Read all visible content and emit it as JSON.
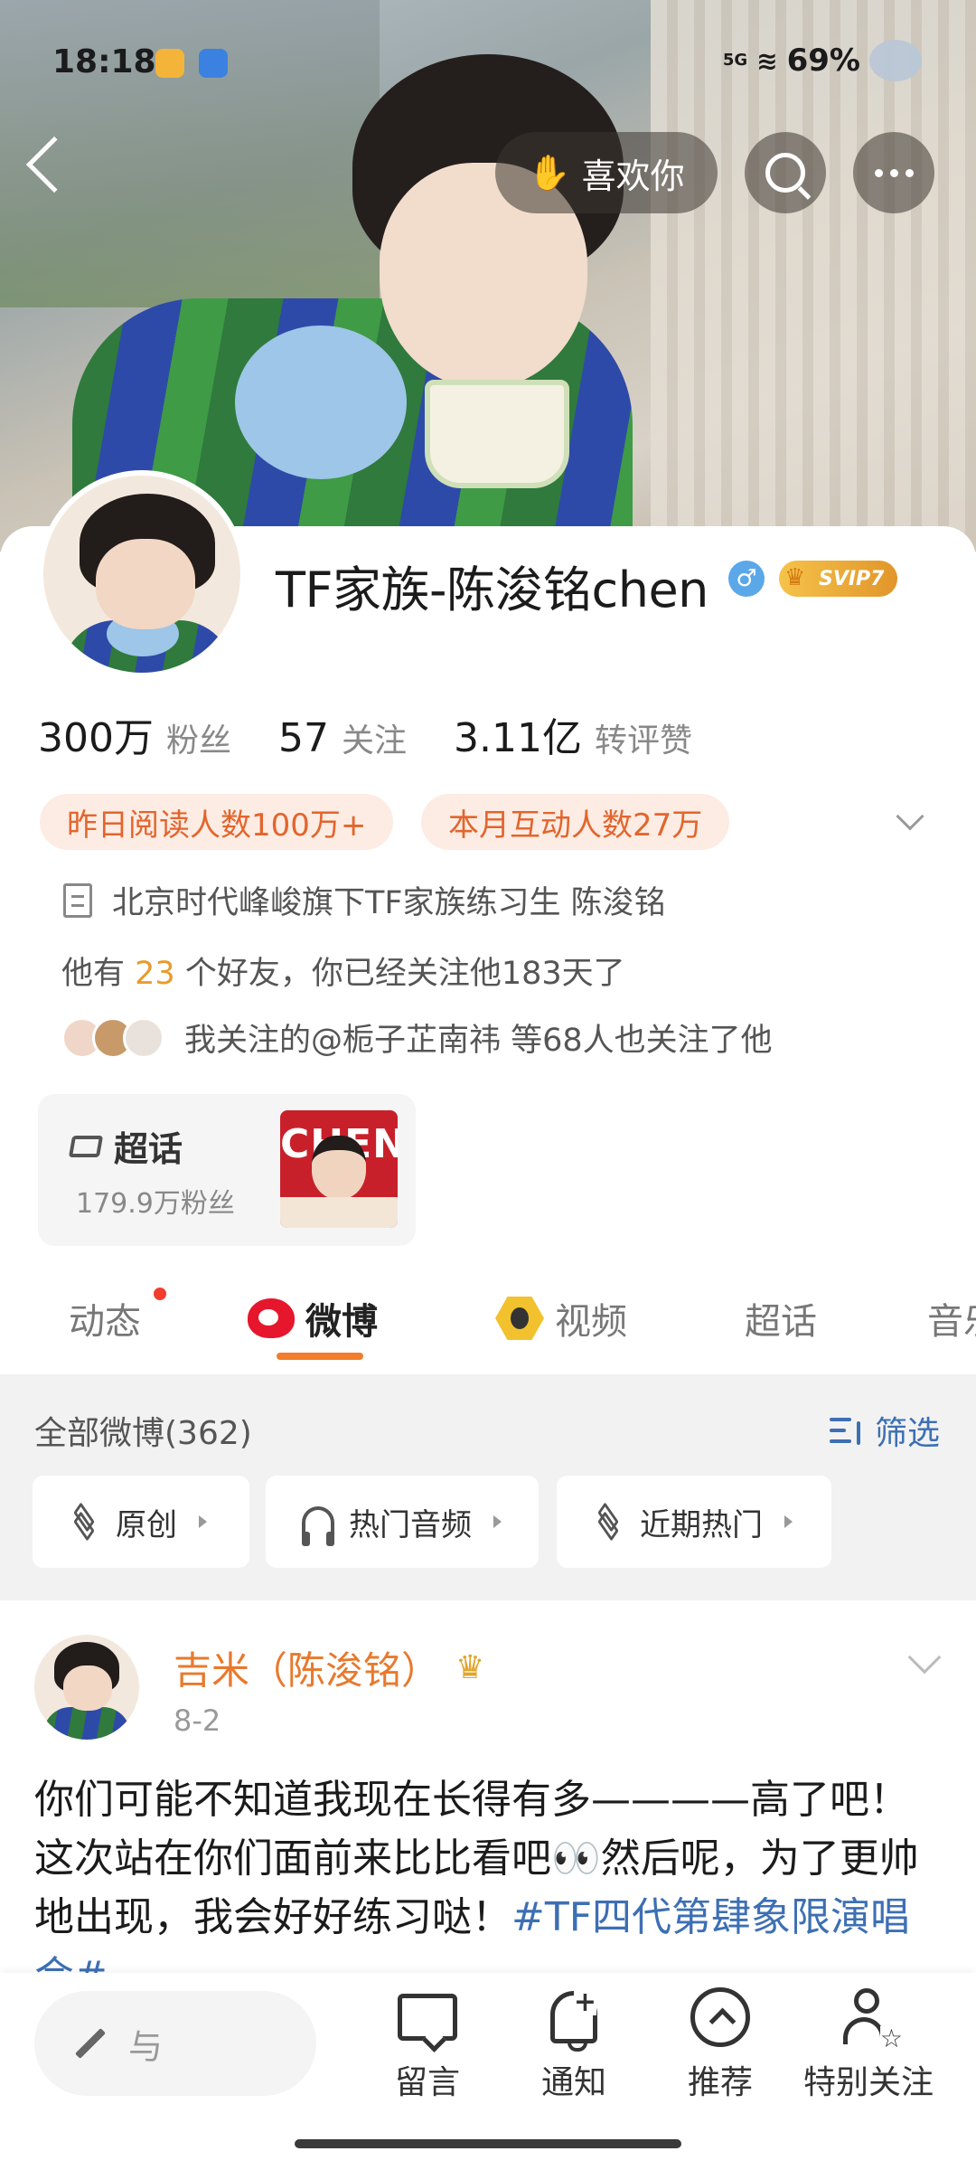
{
  "status_bar": {
    "time": "18:18",
    "network": "5G",
    "battery": "69%"
  },
  "top_bar": {
    "like_label": "喜欢你"
  },
  "profile": {
    "name": "TF家族-陈浚铭chen",
    "gender_symbol": "♂",
    "vip_badge": "SVIP7",
    "stats": [
      {
        "value": "300万",
        "label": "粉丝"
      },
      {
        "value": "57",
        "label": "关注"
      },
      {
        "value": "3.11亿",
        "label": "转评赞"
      }
    ],
    "pills": [
      "昨日阅读人数100万+",
      "本月互动人数27万"
    ],
    "intro": "北京时代峰峻旗下TF家族练习生  陈浚铭",
    "friends_prefix": "他有 ",
    "friends_count": "23",
    "friends_suffix": " 个好友，你已经关注他183天了",
    "mutual_text": "我关注的@栀子芷南祎 等68人也关注了他",
    "super_topic": {
      "title": "超话",
      "fans": "179.9万粉丝",
      "thumb_text": "CHEN"
    }
  },
  "tabs": [
    {
      "label": "动态",
      "active": false
    },
    {
      "label": "微博",
      "active": true
    },
    {
      "label": "视频",
      "active": false
    },
    {
      "label": "超话",
      "active": false
    },
    {
      "label": "音乐",
      "active": false
    }
  ],
  "feed_header": {
    "all_label": "全部微博(362)",
    "filter_label": "筛选",
    "chips": [
      "原创",
      "热门音频",
      "近期热门"
    ]
  },
  "post": {
    "author": "吉米（陈浚铭）",
    "date": "8-2",
    "text": "你们可能不知道我现在长得有多————高了吧！这次站在你们面前来比比看吧👀然后呢，为了更帅地出现，我会好好练习哒！",
    "topic": "#TF四代第肆象限演唱会#"
  },
  "bottom_bar": {
    "comment_placeholder": "与",
    "items": [
      "留言",
      "通知",
      "推荐",
      "特别关注"
    ]
  },
  "colors": {
    "accent_orange": "#e8792d",
    "link_blue": "#3d6fb4",
    "pill_bg": "#fdece3",
    "pill_text": "#e2652d",
    "weibo_red": "#e6162d"
  }
}
